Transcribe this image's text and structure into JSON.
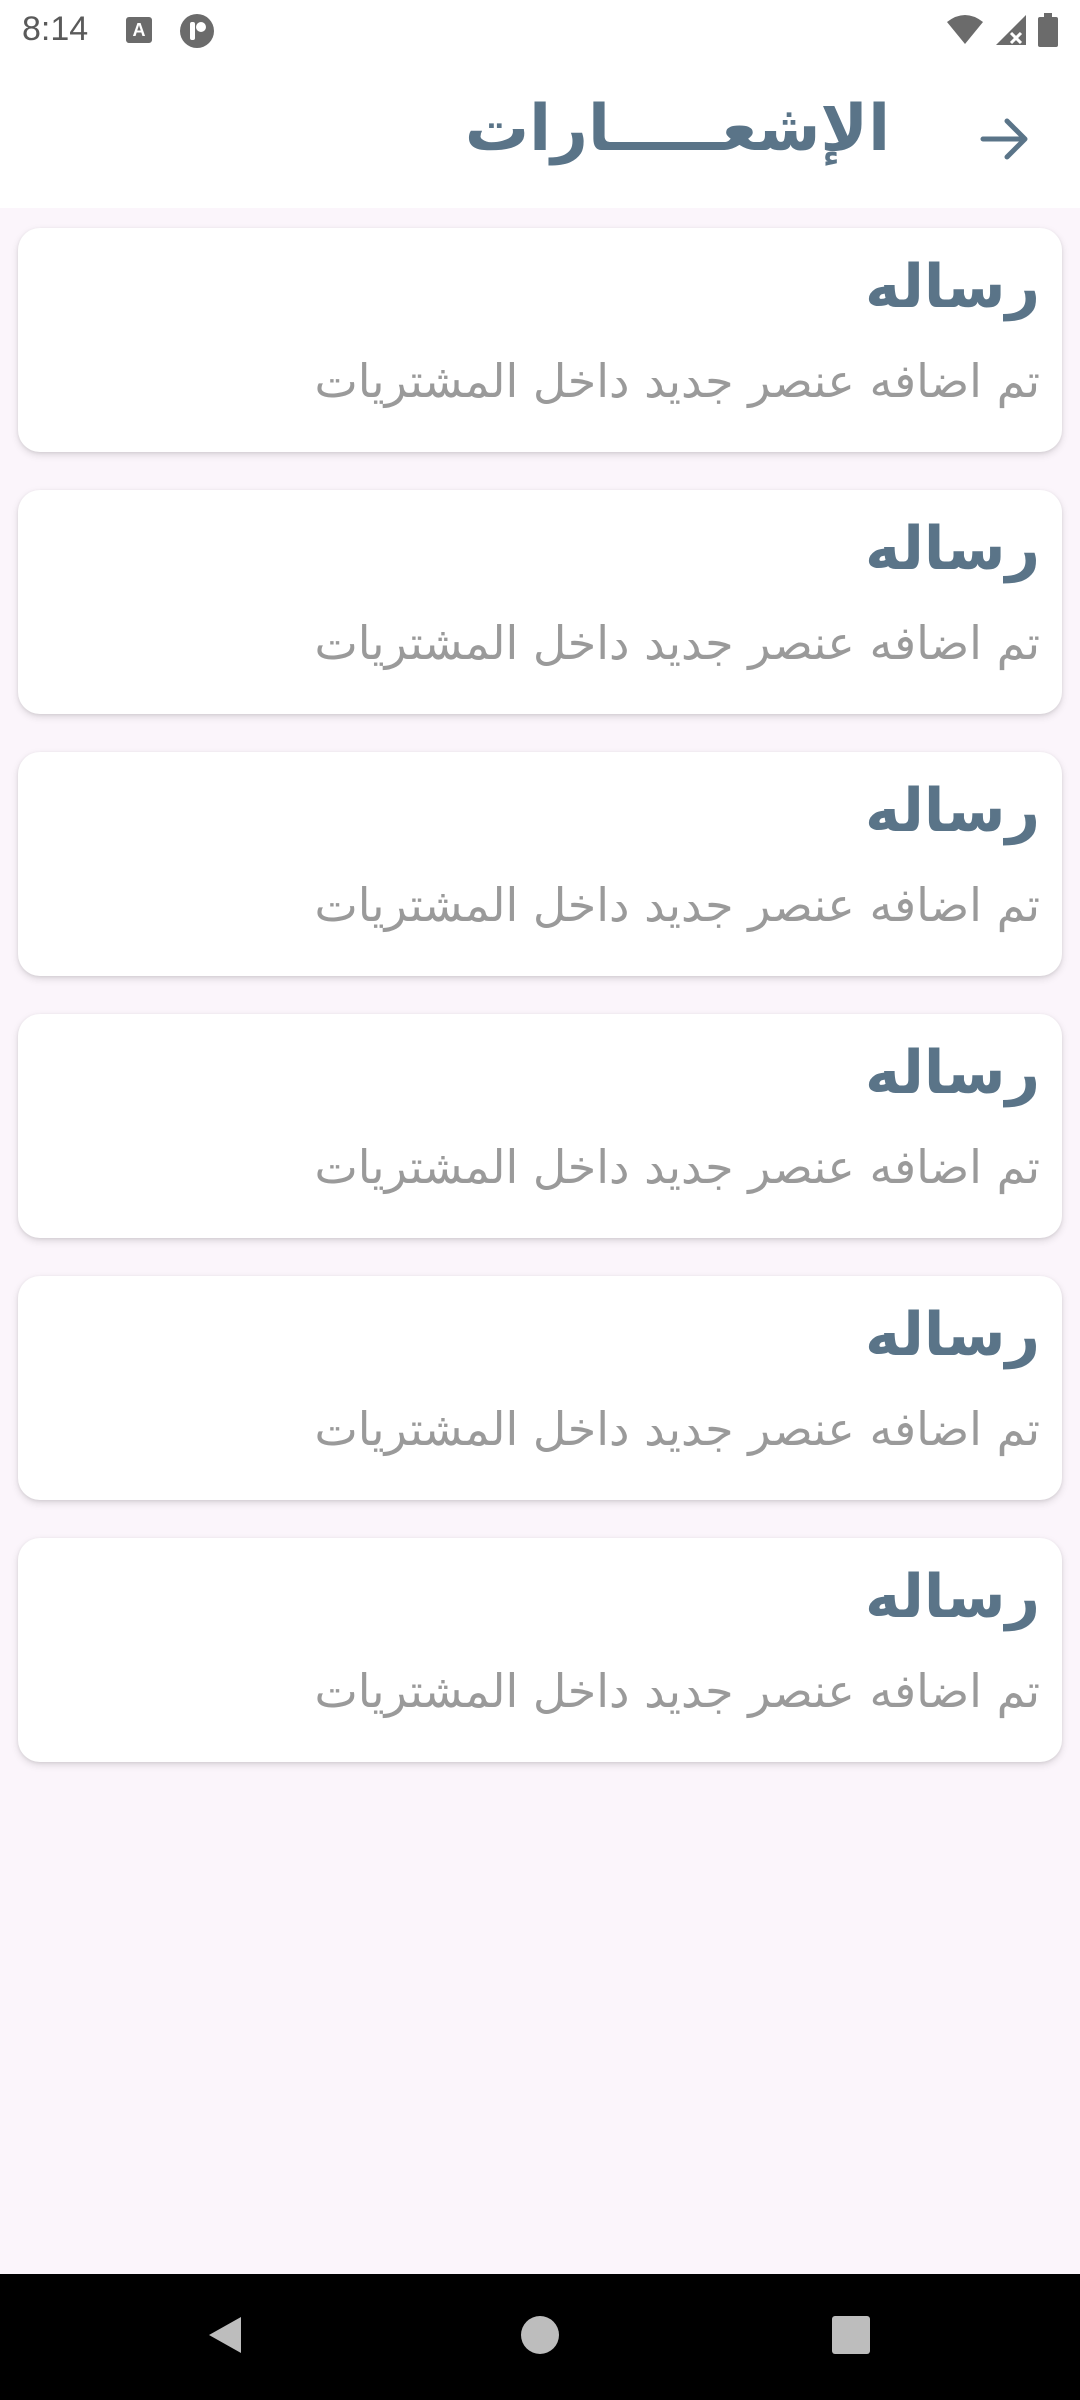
{
  "status_bar": {
    "time": "8:14",
    "icons": [
      "a-box-icon",
      "circle-p-icon",
      "wifi-icon",
      "signal-x-icon",
      "battery-icon"
    ]
  },
  "app_bar": {
    "title": "الإشعـــــارات",
    "back_icon": "arrow-right-icon"
  },
  "notifications": [
    {
      "title": "رساله",
      "body": "تم اضافه عنصر جديد داخل المشتريات"
    },
    {
      "title": "رساله",
      "body": "تم اضافه عنصر جديد داخل المشتريات"
    },
    {
      "title": "رساله",
      "body": "تم اضافه عنصر جديد داخل المشتريات"
    },
    {
      "title": "رساله",
      "body": "تم اضافه عنصر جديد داخل المشتريات"
    },
    {
      "title": "رساله",
      "body": "تم اضافه عنصر جديد داخل المشتريات"
    },
    {
      "title": "رساله",
      "body": "تم اضافه عنصر جديد داخل المشتريات"
    }
  ],
  "nav_bar": {
    "buttons": [
      "back-triangle-icon",
      "home-circle-icon",
      "recents-square-icon"
    ]
  },
  "colors": {
    "accent": "#5a7488",
    "body_text": "#9a9a9a",
    "background": "#fbf5fb",
    "card": "#ffffff"
  }
}
